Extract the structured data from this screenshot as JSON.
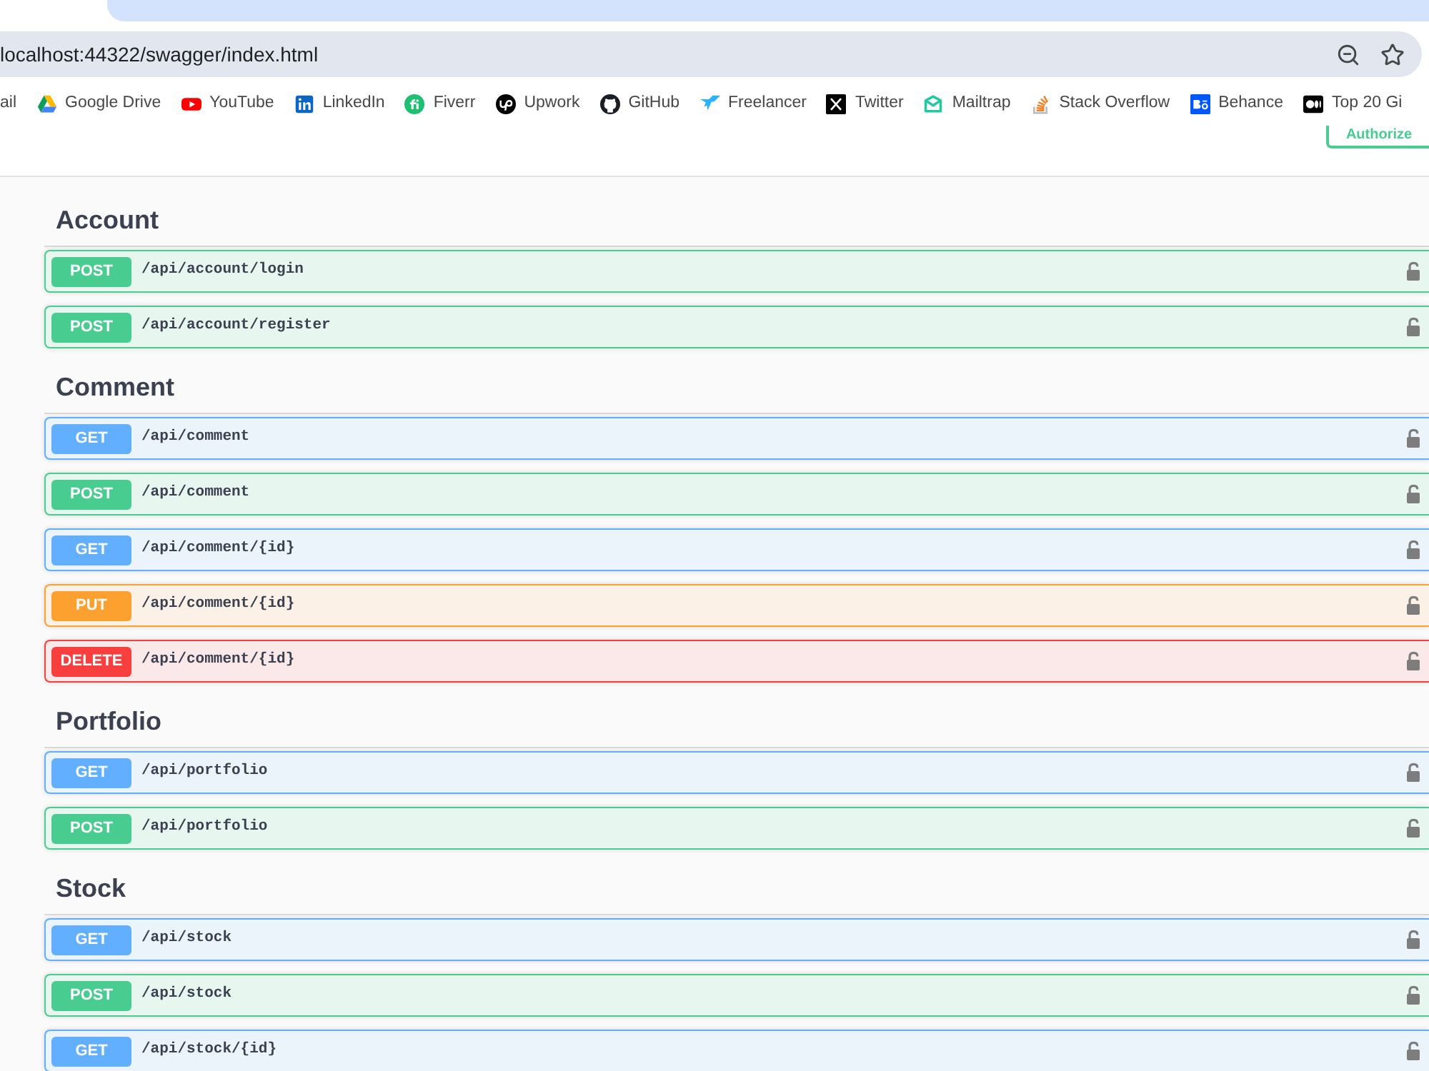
{
  "browser": {
    "address": "localhost:44322/swagger/index.html",
    "bookmarks": [
      {
        "label": "ail"
      },
      {
        "label": "Google Drive",
        "kind": "drive"
      },
      {
        "label": "YouTube",
        "kind": "youtube"
      },
      {
        "label": "LinkedIn",
        "kind": "linkedin"
      },
      {
        "label": "Fiverr",
        "kind": "fiverr"
      },
      {
        "label": "Upwork",
        "kind": "upwork"
      },
      {
        "label": "GitHub",
        "kind": "github"
      },
      {
        "label": "Freelancer",
        "kind": "freelancer"
      },
      {
        "label": "Twitter",
        "kind": "x"
      },
      {
        "label": "Mailtrap",
        "kind": "mailtrap"
      },
      {
        "label": "Stack Overflow",
        "kind": "stackoverflow"
      },
      {
        "label": "Behance",
        "kind": "behance"
      },
      {
        "label": "Top 20 Gi",
        "kind": "medium"
      }
    ]
  },
  "authorize_button": {
    "label": "Authorize"
  },
  "sections": [
    {
      "title": "Account",
      "operations": [
        {
          "kind": "post",
          "method": "POST",
          "path": "/api/account/login"
        },
        {
          "kind": "post",
          "method": "POST",
          "path": "/api/account/register"
        }
      ]
    },
    {
      "title": "Comment",
      "operations": [
        {
          "kind": "get",
          "method": "GET",
          "path": "/api/comment"
        },
        {
          "kind": "post",
          "method": "POST",
          "path": "/api/comment"
        },
        {
          "kind": "get",
          "method": "GET",
          "path": "/api/comment/{id}"
        },
        {
          "kind": "put",
          "method": "PUT",
          "path": "/api/comment/{id}"
        },
        {
          "kind": "delete",
          "method": "DELETE",
          "path": "/api/comment/{id}"
        }
      ]
    },
    {
      "title": "Portfolio",
      "operations": [
        {
          "kind": "get",
          "method": "GET",
          "path": "/api/portfolio"
        },
        {
          "kind": "post",
          "method": "POST",
          "path": "/api/portfolio"
        }
      ]
    },
    {
      "title": "Stock",
      "operations": [
        {
          "kind": "get",
          "method": "GET",
          "path": "/api/stock"
        },
        {
          "kind": "post",
          "method": "POST",
          "path": "/api/stock"
        },
        {
          "kind": "get",
          "method": "GET",
          "path": "/api/stock/{id}"
        }
      ]
    }
  ]
}
